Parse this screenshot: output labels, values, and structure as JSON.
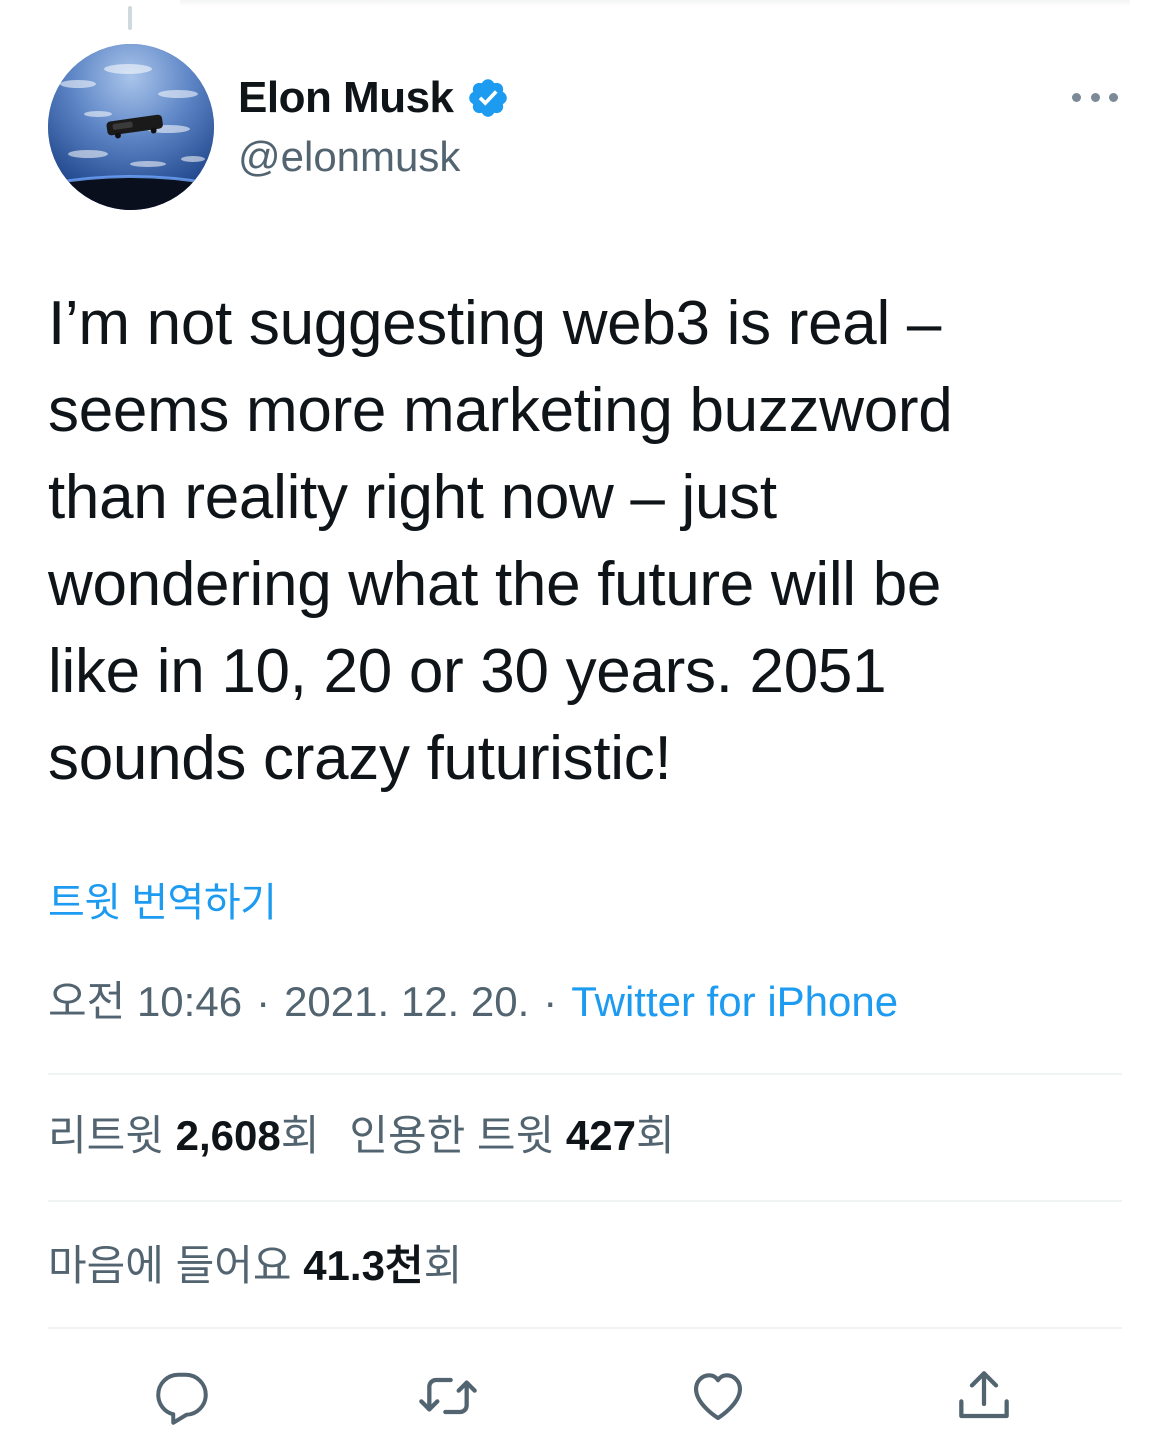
{
  "author": {
    "name": "Elon Musk",
    "handle": "@elonmusk",
    "verified": true
  },
  "tweet": {
    "text": "I’m not suggesting web3 is real –\nseems more marketing buzzword\nthan reality right now – just\nwondering what the future will be\nlike in 10, 20 or 30 years. 2051\nsounds crazy futuristic!",
    "translate_label": "트윗 번역하기",
    "time": "오전 10:46",
    "date": "2021. 12. 20.",
    "source": "Twitter for iPhone",
    "separator": "·"
  },
  "stats": {
    "retweets_label": "리트윗",
    "retweets_value": "2,608",
    "retweets_unit": "회",
    "quotes_label": "인용한 트윗",
    "quotes_value": "427",
    "quotes_unit": "회",
    "likes_label": "마음에 들어요",
    "likes_value": "41.3천",
    "likes_unit": "회"
  },
  "actions": [
    {
      "icon": "reply-icon"
    },
    {
      "icon": "retweet-icon"
    },
    {
      "icon": "like-icon"
    },
    {
      "icon": "share-icon"
    }
  ],
  "colors": {
    "accent": "#1d9bf0",
    "secondary_text": "#536471",
    "primary_text": "#0f1419",
    "divider": "#eff3f4"
  }
}
